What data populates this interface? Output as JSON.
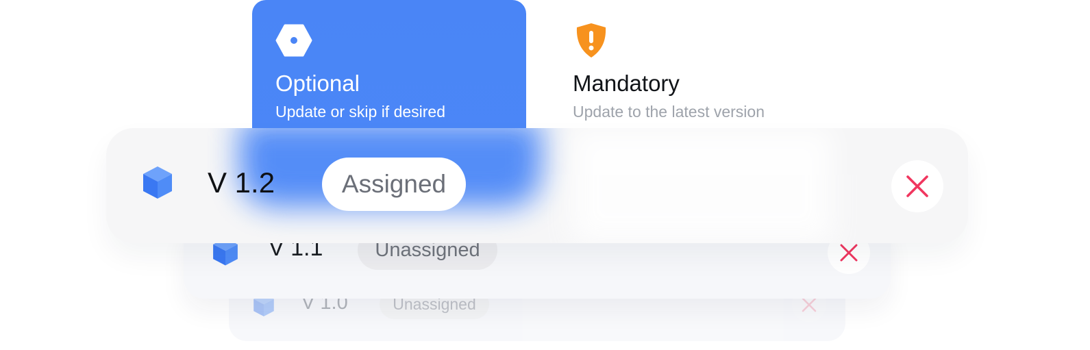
{
  "tabs": {
    "optional": {
      "title": "Optional",
      "subtitle": "Update or skip if desired",
      "icon": "hexagon-dot-icon",
      "selected": true
    },
    "mandatory": {
      "title": "Mandatory",
      "subtitle": "Update to the latest version",
      "icon": "shield-exclamation-icon",
      "selected": false
    }
  },
  "versions": [
    {
      "label": "V 1.2",
      "status": "Assigned",
      "icon": "cube-icon",
      "action_icon": "close-icon"
    },
    {
      "label": "V 1.1",
      "status": "Unassigned",
      "icon": "cube-icon",
      "action_icon": "close-icon"
    },
    {
      "label": "V 1.0",
      "status": "Unassigned",
      "icon": "cube-icon",
      "action_icon": "close-icon"
    }
  ],
  "colors": {
    "accent": "#4a85f6",
    "warning": "#f7921e",
    "danger": "#f0365f",
    "text_primary": "#111418",
    "text_muted": "#9ea3ab"
  }
}
